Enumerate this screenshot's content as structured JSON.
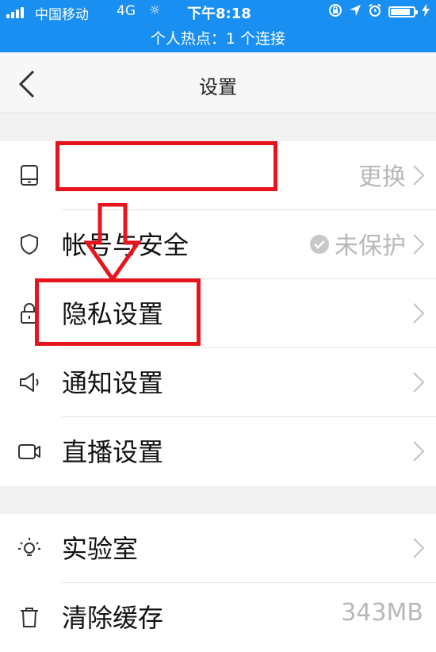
{
  "status_bar": {
    "carrier": "中国移动",
    "network": "4G",
    "loading_glyph": "☼",
    "time": "下午8:18",
    "hotspot": "个人热点：1 个连接"
  },
  "nav": {
    "title": "设置"
  },
  "groups": [
    {
      "items": [
        {
          "label": "",
          "value": "更换"
        },
        {
          "label": "帐号与安全",
          "value": "未保护"
        },
        {
          "label": "隐私设置",
          "value": ""
        },
        {
          "label": "通知设置",
          "value": ""
        },
        {
          "label": "直播设置",
          "value": ""
        }
      ]
    },
    {
      "items": [
        {
          "label": "实验室",
          "value": ""
        },
        {
          "label": "清除缓存",
          "value": "343MB"
        }
      ]
    }
  ],
  "icons": {
    "phone": "phone-icon",
    "shield": "shield-icon",
    "lock": "lock-icon",
    "notify": "speaker-icon",
    "live": "video-camera-icon",
    "lab": "lightbulb-icon",
    "cache": "trash-icon",
    "check": "check-circle-icon",
    "chevron": "chevron-right-icon"
  },
  "colors": {
    "status_bar": "#1a8ff2",
    "annotation": "#e8141d",
    "value_text": "#b8b8b8",
    "page_bg": "#f2f2f2"
  }
}
